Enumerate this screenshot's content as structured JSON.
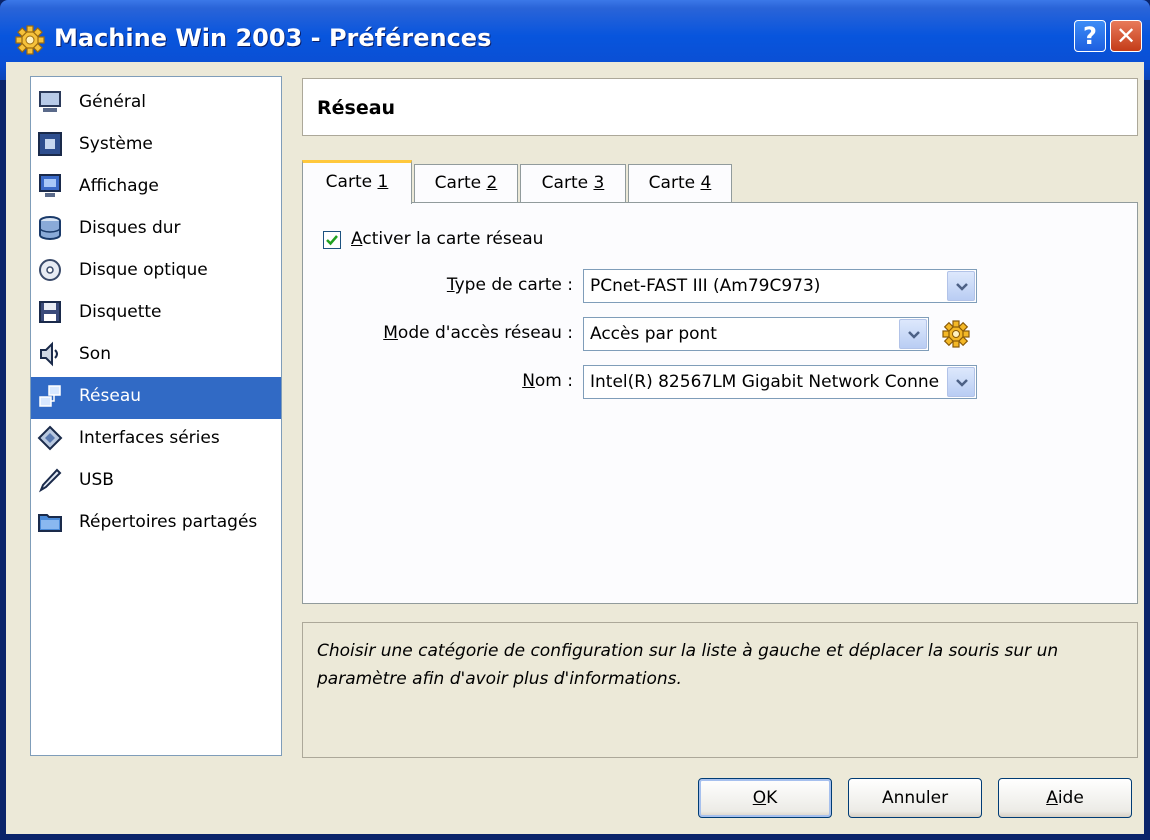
{
  "window": {
    "title": "Machine Win 2003 - Préférences",
    "help_btn": "?",
    "close_btn": "✕"
  },
  "sidebar": {
    "items": [
      {
        "label": "Général",
        "icon": "monitor-icon"
      },
      {
        "label": "Système",
        "icon": "chip-icon"
      },
      {
        "label": "Affichage",
        "icon": "display-icon"
      },
      {
        "label": "Disques dur",
        "icon": "harddisk-icon"
      },
      {
        "label": "Disque optique",
        "icon": "cd-icon"
      },
      {
        "label": "Disquette",
        "icon": "floppy-icon"
      },
      {
        "label": "Son",
        "icon": "speaker-icon"
      },
      {
        "label": "Réseau",
        "icon": "network-icon",
        "selected": true
      },
      {
        "label": "Interfaces séries",
        "icon": "serial-icon"
      },
      {
        "label": "USB",
        "icon": "usb-icon"
      },
      {
        "label": "Répertoires partagés",
        "icon": "folder-icon"
      }
    ]
  },
  "header": {
    "title": "Réseau"
  },
  "tabs": {
    "t1": {
      "pre": "Carte ",
      "key": "1"
    },
    "t2": {
      "pre": "Carte ",
      "key": "2"
    },
    "t3": {
      "pre": "Carte ",
      "key": "3"
    },
    "t4": {
      "pre": "Carte ",
      "key": "4"
    }
  },
  "panel": {
    "enable": {
      "key": "A",
      "rest": "ctiver la carte réseau",
      "checked": true
    },
    "type": {
      "key": "T",
      "rest": "ype de carte :",
      "value": "PCnet-FAST III (Am79C973)"
    },
    "mode": {
      "key": "M",
      "rest": "ode d'accès réseau :",
      "value": "Accès par pont"
    },
    "name": {
      "key": "N",
      "rest": "om :",
      "value": "Intel(R) 82567LM Gigabit Network Conne"
    }
  },
  "info": {
    "text": "Choisir une catégorie de configuration sur la liste à gauche et déplacer la souris sur un paramètre afin d'avoir plus d'informations."
  },
  "buttons": {
    "ok": {
      "key": "O",
      "rest": "K"
    },
    "cancel": {
      "label": "Annuler"
    },
    "help": {
      "key": "A",
      "rest": "ide"
    }
  },
  "colors": {
    "selection": "#316ac5",
    "titlebar": "#0855dd",
    "tab_highlight": "#ffc83c"
  }
}
